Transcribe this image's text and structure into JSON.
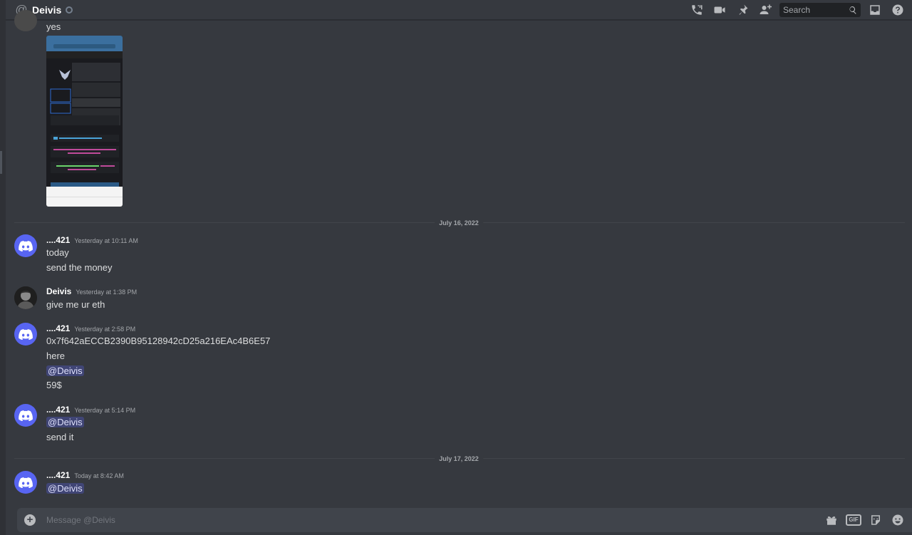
{
  "header": {
    "at_symbol": "@",
    "username": "Deivis",
    "search_placeholder": "Search",
    "icons": [
      "voice-call-icon",
      "video-call-icon",
      "pin-icon",
      "add-friend-icon",
      "search-icon",
      "inbox-icon",
      "help-icon"
    ]
  },
  "messages": {
    "top_text": "yes",
    "divider1": "July 16, 2022",
    "m1": {
      "author": "....421",
      "time": "Yesterday at 10:11 AM",
      "lines": [
        "today",
        "send the money"
      ]
    },
    "m2": {
      "author": "Deivis",
      "time": "Yesterday at 1:38 PM",
      "lines": [
        "give me ur eth"
      ]
    },
    "m3": {
      "author": "....421",
      "time": "Yesterday at 2:58 PM",
      "lines": [
        "0x7f642aECCB2390B95128942cD25a216EAc4B6E57",
        "here",
        "@Deivis",
        "59$"
      ]
    },
    "m4": {
      "author": "....421",
      "time": "Yesterday at 5:14 PM",
      "lines": [
        "@Deivis",
        "send it"
      ]
    },
    "divider2": "July 17, 2022",
    "m5": {
      "author": "....421",
      "time": "Today at 8:42 AM",
      "lines": [
        "@Deivis"
      ]
    }
  },
  "composer": {
    "placeholder": "Message @Deivis",
    "gif_label": "GIF",
    "icons": [
      "gift-icon",
      "gif-icon",
      "sticker-icon",
      "emoji-icon"
    ]
  },
  "colors": {
    "background": "#36393f",
    "accent": "#5865f2",
    "mention_bg": "#4a4f88"
  }
}
